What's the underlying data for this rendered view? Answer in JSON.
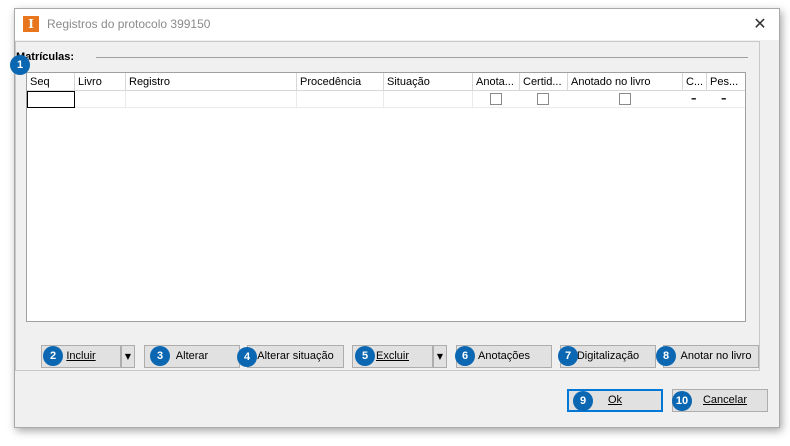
{
  "window": {
    "title": "Registros do protocolo 399150",
    "app_icon": "I",
    "close_glyph": "✕"
  },
  "group": {
    "title": "Matrículas:"
  },
  "grid": {
    "columns": [
      "Seq",
      "Livro",
      "Registro",
      "Procedência",
      "Situação",
      "Anota...",
      "Certid...",
      "Anotado no livro",
      "C...",
      "Pes..."
    ],
    "row": {
      "c_value": "–",
      "pes_value": "–"
    }
  },
  "badges": [
    "1",
    "2",
    "3",
    "4",
    "5",
    "6",
    "7",
    "8",
    "9",
    "10"
  ],
  "buttons": {
    "incluir": "Incluir",
    "alterar": "Alterar",
    "alterar_situacao": "Alterar situação",
    "excluir": "Excluir",
    "anotacoes": "Anotações",
    "digitalizacao": "Digitalização",
    "anotar_no_livro": "Anotar no livro",
    "ok": "Ok",
    "cancelar": "Cancelar",
    "dropdown_glyph": "▼"
  }
}
